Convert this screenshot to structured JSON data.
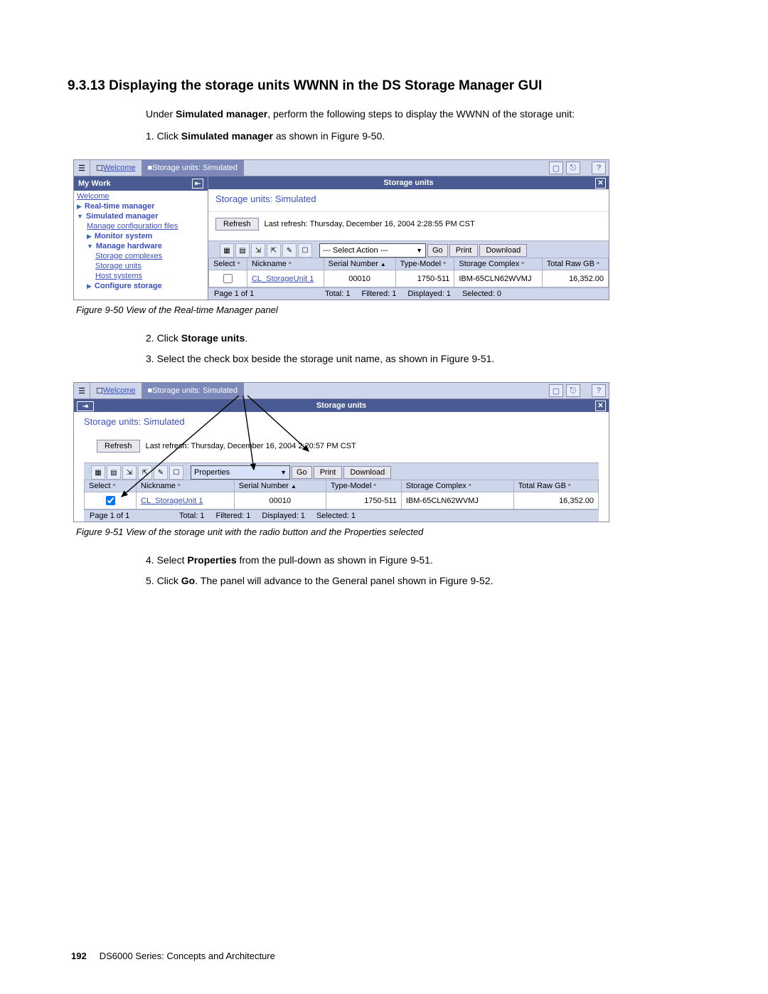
{
  "section_heading": "9.3.13  Displaying the storage units WWNN in the DS Storage Manager GUI",
  "intro_pre": "Under ",
  "intro_bold": "Simulated manager",
  "intro_post": ", perform the following steps to display the WWNN of the storage unit:",
  "step1_pre": "1.  Click ",
  "step1_bold": "Simulated manager",
  "step1_post": " as shown in Figure 9-50.",
  "caption1": "Figure 9-50   View of the Real-time Manager panel",
  "step2_pre": "2.  Click ",
  "step2_bold": "Storage units",
  "step2_post": ".",
  "step3": "3.  Select the check box beside the storage unit name, as shown in Figure 9-51.",
  "caption2": "Figure 9-51   View of the storage unit with the radio button and the Properties selected",
  "step4_pre": "4.  Select ",
  "step4_bold": "Properties",
  "step4_post": " from the pull-down as shown in Figure 9-51.",
  "step5_pre": "5.  Click ",
  "step5_bold": "Go",
  "step5_post": ". The panel will advance to the General panel shown in Figure 9-52.",
  "footer_page": "192",
  "footer_text": "DS6000 Series: Concepts and Architecture",
  "ss1": {
    "tab_welcome": "Welcome",
    "tab_storage": "Storage units: Simulated",
    "mywork_label": "My Work",
    "nav": {
      "welcome": "Welcome",
      "realtime": "Real-time manager",
      "simulated": "Simulated manager",
      "manage_config": "Manage configuration files",
      "monitor": "Monitor system",
      "manage_hw": "Manage hardware",
      "storage_complexes": "Storage complexes",
      "storage_units": "Storage units",
      "host_systems": "Host systems",
      "configure_storage": "Configure storage"
    },
    "content_header": "Storage units",
    "content_title": "Storage units: Simulated",
    "refresh_btn": "Refresh",
    "refresh_text": "Last refresh: Thursday, December 16, 2004 2:28:55 PM CST",
    "select_action": "--- Select Action ---",
    "go_btn": "Go",
    "print_btn": "Print",
    "download_btn": "Download",
    "columns": {
      "select": "Select",
      "nickname": "Nickname",
      "serial": "Serial Number",
      "type": "Type-Model",
      "complex": "Storage Complex",
      "raw": "Total Raw GB"
    },
    "row": {
      "nickname": "CL_StorageUnit 1",
      "serial": "00010",
      "type": "1750-511",
      "complex": "IBM-65CLN62WVMJ",
      "raw": "16,352.00"
    },
    "pager": {
      "page": "Page 1 of 1",
      "total": "Total: 1",
      "filtered": "Filtered: 1",
      "displayed": "Displayed: 1",
      "selected": "Selected: 0"
    }
  },
  "ss2": {
    "tab_welcome": "Welcome",
    "tab_storage": "Storage units: Simulated",
    "content_header": "Storage units",
    "content_title": "Storage units: Simulated",
    "refresh_btn": "Refresh",
    "refresh_text": "Last refresh: Thursday, December 16, 2004 2:20:57 PM CST",
    "select_action": "Properties",
    "go_btn": "Go",
    "print_btn": "Print",
    "download_btn": "Download",
    "columns": {
      "select": "Select",
      "nickname": "Nickname",
      "serial": "Serial Number",
      "type": "Type-Model",
      "complex": "Storage Complex",
      "raw": "Total Raw GB"
    },
    "row": {
      "nickname": "CL_StorageUnit 1",
      "serial": "00010",
      "type": "1750-511",
      "complex": "IBM-65CLN62WVMJ",
      "raw": "16,352.00"
    },
    "pager": {
      "page": "Page 1 of 1",
      "total": "Total: 1",
      "filtered": "Filtered: 1",
      "displayed": "Displayed: 1",
      "selected": "Selected: 1"
    }
  }
}
